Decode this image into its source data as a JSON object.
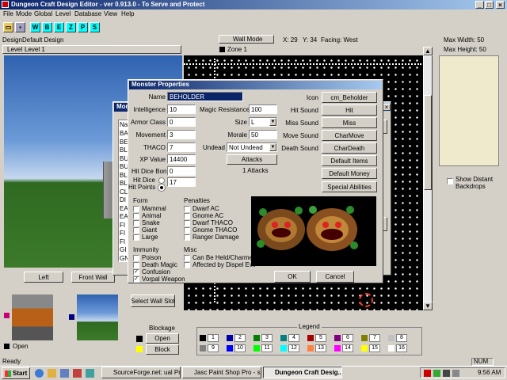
{
  "window": {
    "title": "Dungeon Craft Design Editor - ver 0.913.0 - To Serve and Protect"
  },
  "menu": [
    "File",
    "Mode",
    "Global",
    "Level",
    "Database",
    "View",
    "Help"
  ],
  "toolbar": {
    "letters": [
      "W",
      "B",
      "E",
      "Z",
      "P",
      "S"
    ]
  },
  "header": {
    "design_label": "Design",
    "design_name": "Default Design",
    "level_label": "Level",
    "level_name": "Level 1",
    "mode": "Wall Mode",
    "x": "X: 29",
    "y": "Y: 34",
    "facing": "Facing: West",
    "zone": "Zone 1",
    "max_width": "Max Width: 50",
    "max_height": "Max Height: 50"
  },
  "left_panel": {
    "btn_left": "Left",
    "btn_front": "Front Wall",
    "select_wall_slot": "Select Wall Slot",
    "open": "Open",
    "show_distant": "Show Distant Backdrops"
  },
  "blockage": {
    "title": "Blockage",
    "open": "Open",
    "block": "Block"
  },
  "legend": {
    "title": "Legend",
    "items": [
      {
        "n": "1",
        "color": "#000000"
      },
      {
        "n": "2",
        "color": "#0000a8"
      },
      {
        "n": "3",
        "color": "#008000"
      },
      {
        "n": "4",
        "color": "#008080"
      },
      {
        "n": "5",
        "color": "#a80000"
      },
      {
        "n": "6",
        "color": "#800080"
      },
      {
        "n": "7",
        "color": "#808000"
      },
      {
        "n": "8",
        "color": "#c0c0c0"
      },
      {
        "n": "9",
        "color": "#808080"
      },
      {
        "n": "10",
        "color": "#0000ff"
      },
      {
        "n": "11",
        "color": "#00ff00"
      },
      {
        "n": "12",
        "color": "#00ffff"
      },
      {
        "n": "13",
        "color": "#ff8040"
      },
      {
        "n": "14",
        "color": "#ff00ff"
      },
      {
        "n": "15",
        "color": "#ffff00"
      },
      {
        "n": "16",
        "color": "#ffffff"
      }
    ]
  },
  "back_dialog": {
    "title_fragment": "Mons",
    "list_fragment": "Na",
    "list_items": [
      "BA",
      "BE",
      "BL",
      "BU",
      "BU",
      "BL",
      "BL",
      "CL",
      "DI",
      "EA",
      "EA",
      "FI",
      "FI",
      "FI",
      "GI",
      "GN"
    ]
  },
  "dialog": {
    "title": "Monster Properties",
    "name_label": "Name",
    "name_value": "BEHOLDER",
    "intelligence_label": "Intelligence",
    "intelligence": "10",
    "armor_label": "Armor Class",
    "armor": "0",
    "movement_label": "Movement",
    "movement": "3",
    "thaco_label": "THACO",
    "thaco": "7",
    "xp_label": "XP Value",
    "xp": "14400",
    "hd_bonus_label": "Hit Dice Bonus",
    "hd_bonus": "0",
    "hit_dice_label": "Hit Dice",
    "hit_points_label": "Hit Points",
    "hit_dice": "17",
    "magic_res_label": "Magic Resistance",
    "magic_res": "100",
    "size_label": "Size",
    "size": "L",
    "morale_label": "Morale",
    "morale": "50",
    "undead_label": "Undead",
    "undead": "Not Undead",
    "attacks_btn": "Attacks",
    "attacks_count": "1 Attacks",
    "icon_label": "Icon",
    "icon_btn": "cm_Beholder",
    "hit_sound_label": "Hit Sound",
    "hit_sound": "Hit",
    "miss_sound_label": "Miss Sound",
    "miss_sound": "Miss",
    "move_sound_label": "Move Sound",
    "move_sound": "CharMove",
    "death_sound_label": "Death Sound",
    "death_sound": "CharDeath",
    "default_items": "Default Items",
    "default_money": "Default Money",
    "special_abilities": "Special Abilities",
    "form_title": "Form",
    "form": [
      "Mammal",
      "Animal",
      "Snake",
      "Giant",
      "Large"
    ],
    "penalties_title": "Penalties",
    "penalties": [
      "Dwarf AC",
      "Gnome AC",
      "Dwarf THACO",
      "Gnome THACO",
      "Ranger Damage"
    ],
    "immunity_title": "Immunity",
    "immunity": [
      "Poison",
      "Death Magic",
      "Confusion",
      "Vorpal Weapon"
    ],
    "immunity_checked": [
      false,
      false,
      true,
      true
    ],
    "misc_title": "Misc",
    "misc": [
      "Can Be Held/Charmed",
      "Affected by Dispel Evil"
    ],
    "ok": "OK",
    "cancel": "Cancel"
  },
  "status": {
    "left": "Ready",
    "num": "NUM"
  },
  "taskbar": {
    "start": "Start",
    "tasks": [
      "SourceForge.net: ual Proje...",
      "Jasc Paint Shop Pro - spell...",
      "Dungeon Craft Desig..."
    ],
    "time": "9:56 AM"
  }
}
